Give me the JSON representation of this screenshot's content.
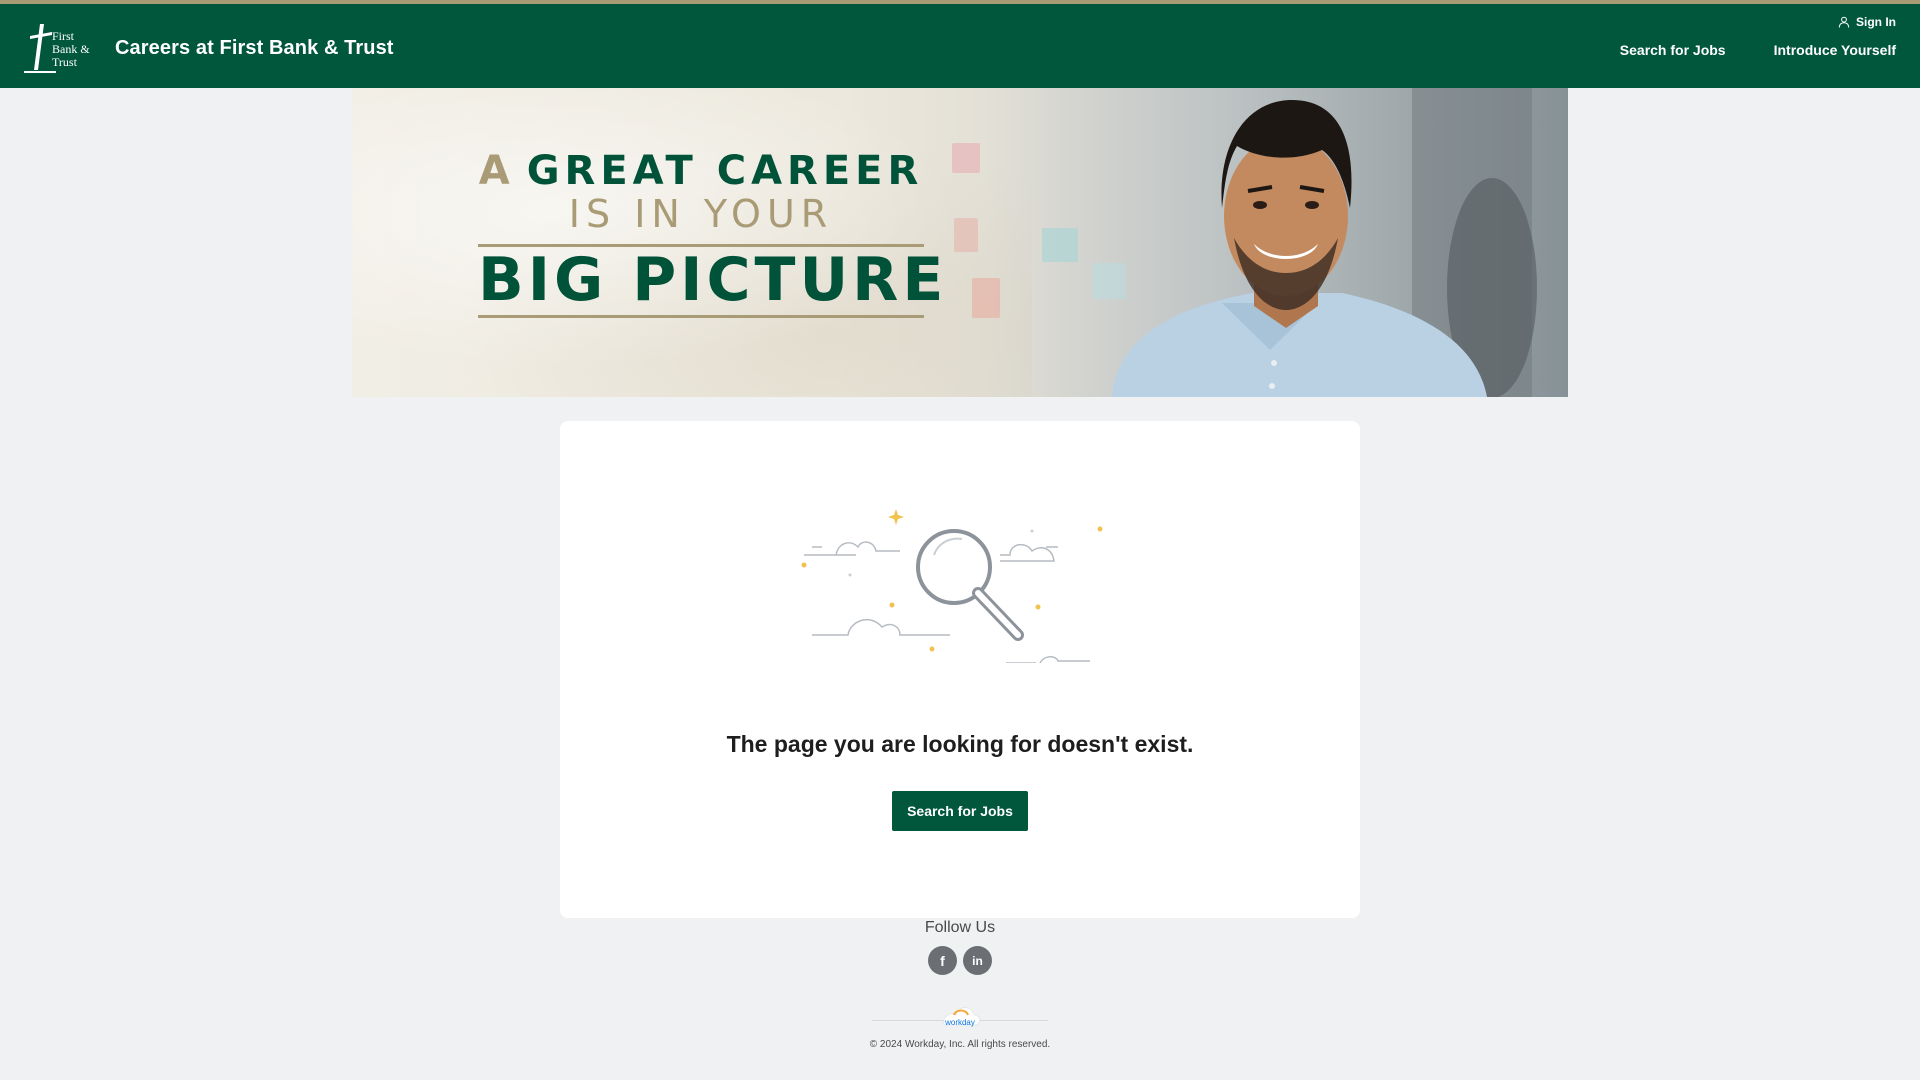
{
  "header": {
    "logo_text": "First Bank & Trust",
    "site_title": "Careers at First Bank & Trust",
    "sign_in_label": "Sign In",
    "nav": [
      {
        "label": "Search for Jobs"
      },
      {
        "label": "Introduce Yourself"
      }
    ]
  },
  "hero": {
    "line1_a": "A",
    "line1_b": "GREAT CAREER",
    "line2": "IS IN YOUR",
    "line3": "BIG PICTURE"
  },
  "main": {
    "message": "The page you are looking for doesn't exist.",
    "cta_label": "Search for Jobs"
  },
  "footer": {
    "follow_label": "Follow Us",
    "social_icons": [
      "facebook-icon",
      "linkedin-icon"
    ],
    "facebook_glyph": "f",
    "linkedin_glyph": "in",
    "workday_logo_text": "workday",
    "copyright": "© 2024 Workday, Inc. All rights reserved."
  },
  "colors": {
    "brand_green": "#00573c",
    "accent_gold": "#a99b75",
    "page_bg": "#f0f1f2"
  }
}
